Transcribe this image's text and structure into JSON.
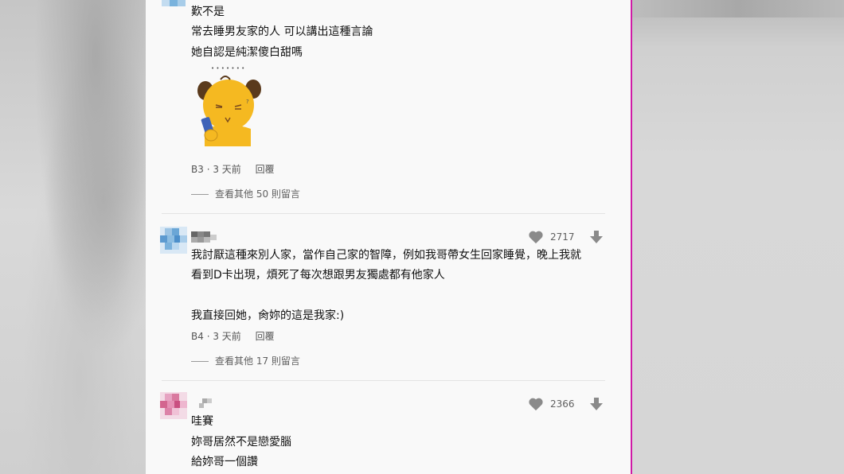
{
  "comments": [
    {
      "lines": [
        "歎不是",
        "常去睡男友家的人 可以講出這種言論",
        "她自認是純潔傻白甜嗎"
      ],
      "sticker_dots": "• • • • • • •",
      "floor": "B3",
      "time": "3 天前",
      "reply_label": "回覆",
      "more_replies": "查看其他 50 則留言"
    },
    {
      "likes": "2717",
      "lines": [
        "我討厭這種來別人家，當作自己家的智障，例如我哥帶女生回家睡覺，晚上我就",
        "看到D卡出現，煩死了每次想跟男友獨處都有他家人",
        "我直接回她，肏妳的這是我家:)"
      ],
      "floor": "B4",
      "time": "3 天前",
      "reply_label": "回覆",
      "more_replies": "查看其他 17 則留言"
    },
    {
      "likes": "2366",
      "lines": [
        "哇賽",
        "妳哥居然不是戀愛腦",
        "給妳哥一個讚"
      ]
    }
  ],
  "meta_separator": "·",
  "colors": {
    "magenta_border": "#d01aa6",
    "panel_bg": "#f9f9f9",
    "sticker_yellow": "#f5b921"
  }
}
